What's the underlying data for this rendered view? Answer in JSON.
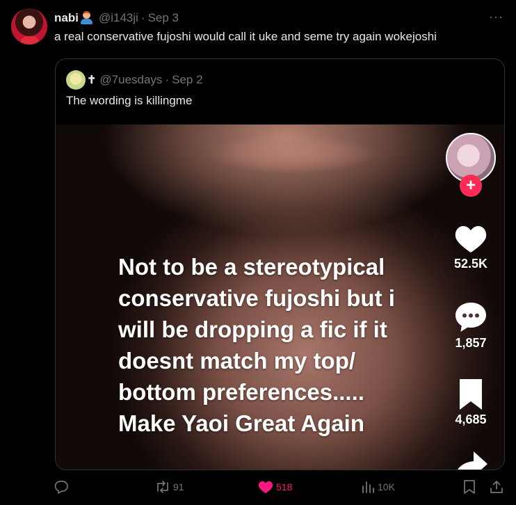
{
  "post": {
    "author_name": "nabi",
    "author_handle": "@i143ji",
    "separator": "·",
    "date": "Sep 3",
    "more": "···",
    "text": "a real conservative fujoshi would call it uke and seme try again wokejoshi"
  },
  "quote": {
    "cross": "✝",
    "author_handle": "@7uesdays",
    "separator": "·",
    "date": "Sep 2",
    "text": "The wording is killingme"
  },
  "video": {
    "overlay_lines": [
      "Not to be a stereotypical",
      "conservative fujoshi but i",
      "will be dropping a fic if it",
      "doesnt match my top/",
      "bottom preferences.....",
      "Make Yaoi Great Again"
    ],
    "follow_symbol": "+",
    "likes": "52.5K",
    "comments": "1,857",
    "saves": "4,685"
  },
  "actions": {
    "replies": "",
    "reposts": "91",
    "likes": "518",
    "views": "10K"
  },
  "colors": {
    "background": "#000000",
    "text": "#e7e9ea",
    "muted": "#71767b",
    "like_active": "#f91880",
    "tiktok_follow": "#fe2c55"
  }
}
